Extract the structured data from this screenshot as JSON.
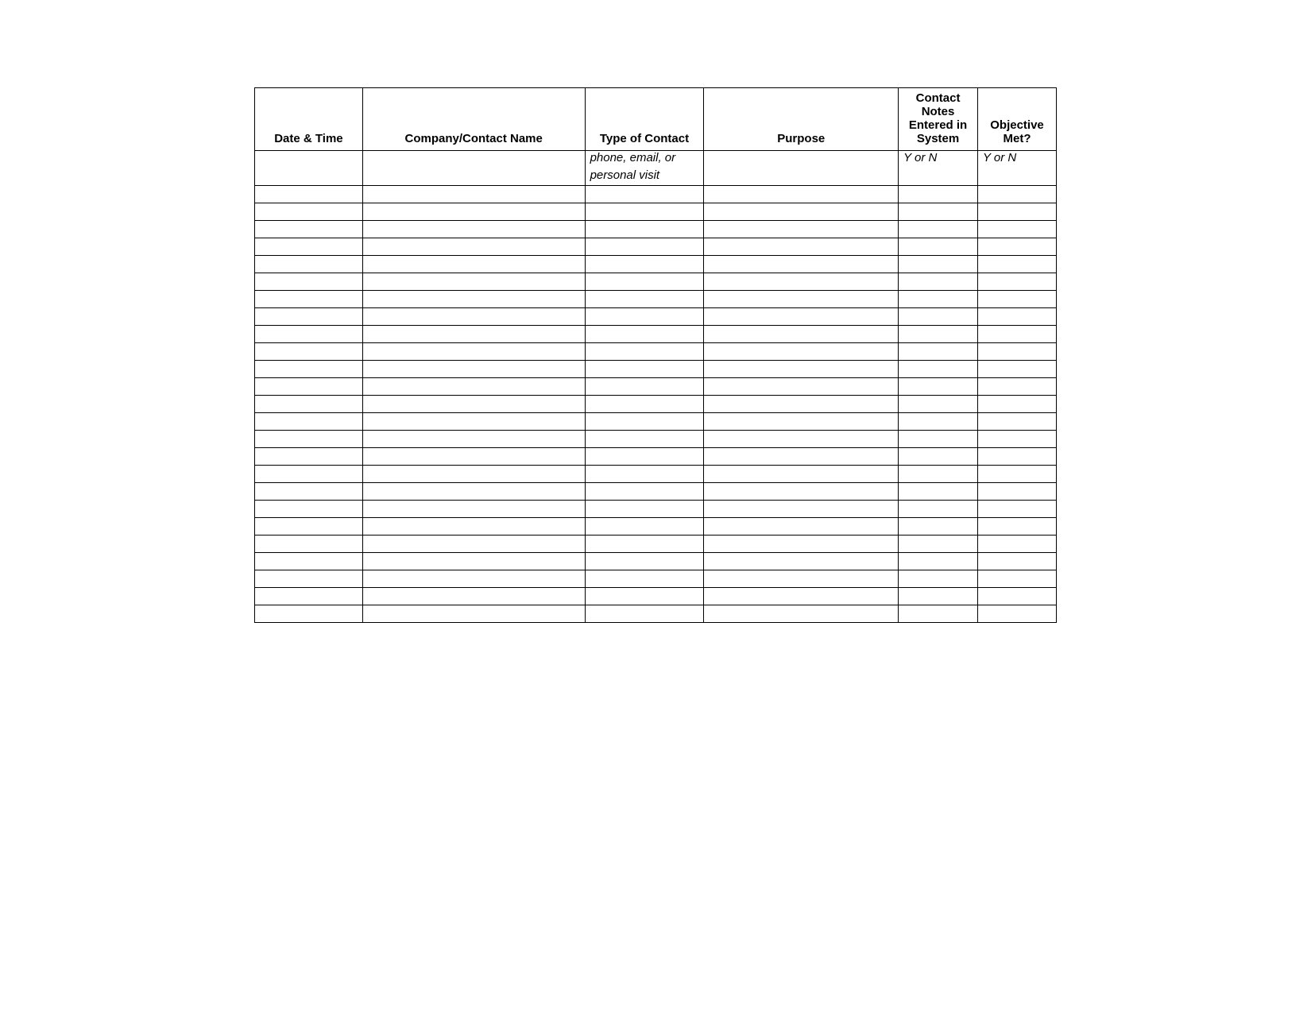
{
  "table": {
    "headers": {
      "date_time": "Date & Time",
      "company_contact": "Company/Contact Name",
      "type_of_contact": "Type of Contact",
      "purpose": "Purpose",
      "contact_notes": "Contact Notes Entered in System",
      "objective_met": "Objective Met?"
    },
    "hints": {
      "type_of_contact_line1": "phone, email, or",
      "type_of_contact_line2": "personal visit",
      "contact_notes": "Y or N",
      "objective_met": "Y or N"
    },
    "empty_row_count": 25
  }
}
